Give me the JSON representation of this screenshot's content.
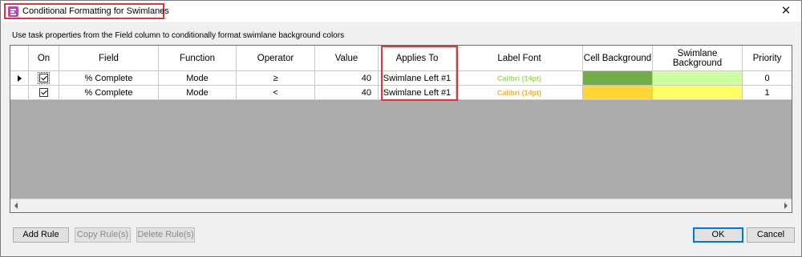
{
  "window": {
    "title": "Conditional Formatting for Swimlanes",
    "close_glyph": "✕"
  },
  "instructions": "Use task properties from the Field column to conditionally format swimlane background colors",
  "grid": {
    "headers": {
      "on": "On",
      "field": "Field",
      "function": "Function",
      "operator": "Operator",
      "value": "Value",
      "applies_to": "Applies To",
      "label_font": "Label Font",
      "cell_background": "Cell Background",
      "swimlane_background": "Swimlane Background",
      "priority": "Priority"
    },
    "rows": [
      {
        "current": true,
        "on": true,
        "field": "% Complete",
        "function": "Mode",
        "operator": "≥",
        "value": "40",
        "applies_to": "Swimlane Left #1",
        "label_font": "Calibri (14pt)",
        "label_font_color": "#9ddb64",
        "cell_background": "#70ad47",
        "swimlane_background": "#ccffa0",
        "priority": "0"
      },
      {
        "current": false,
        "on": true,
        "field": "% Complete",
        "function": "Mode",
        "operator": "<",
        "value": "40",
        "applies_to": "Swimlane Left #1",
        "label_font": "Calibri (14pt)",
        "label_font_color": "#f2b233",
        "cell_background": "#ffd633",
        "swimlane_background": "#ffff66",
        "priority": "1"
      }
    ]
  },
  "buttons": {
    "add_rule": "Add Rule",
    "copy_rules": "Copy Rule(s)",
    "delete_rules": "Delete Rule(s)",
    "ok": "OK",
    "cancel": "Cancel"
  },
  "icons": {
    "app": "conditional-format-icon",
    "close": "close-icon",
    "row_pointer": "current-row-arrow-icon",
    "scroll_left": "scroll-left-arrow-icon",
    "scroll_right": "scroll-right-arrow-icon"
  },
  "colors": {
    "highlight": "#e0353b",
    "grid_empty": "#ababab"
  }
}
